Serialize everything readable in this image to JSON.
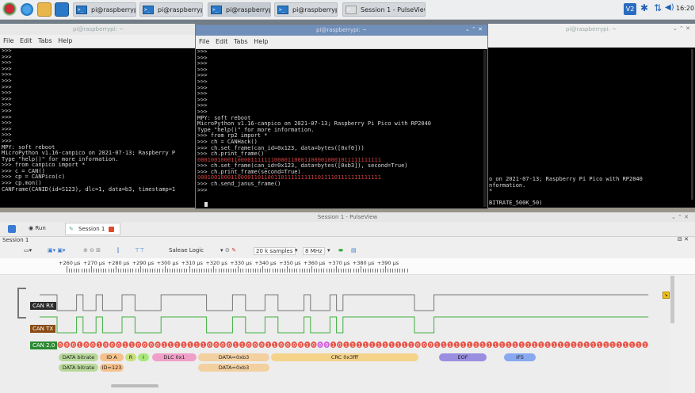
{
  "taskbar": {
    "buttons": [
      "pi@raspberrypi: ~]",
      "pi@raspberrypi: ~",
      "pi@raspberrypi: ~",
      "pi@raspberrypi: ~",
      "Session 1 - PulseView"
    ],
    "clock": "16:20",
    "vnc_label": "V2"
  },
  "term_left": {
    "title": "pi@raspberrypi: ~",
    "menu": [
      "File",
      "Edit",
      "Tabs",
      "Help"
    ],
    "text": ">>>\n>>>\n>>>\n>>>\n>>>\n>>>\n>>>\n>>>\n>>>\n>>>\n>>>\n>>>\n>>>\n>>>\n>>>\n>>>\nMPY: soft reboot\nMicroPython v1.16-canpico on 2021-07-13; Raspberry P\nType \"help()\" for more information.\n>>> from canpico import *\n>>> c = CAN()\n>>> cp = CANPico(c)\n>>> cp.mon()\nCANFrame(CANID(id=S123), dlc=1, data=b3, timestamp=1"
  },
  "term_mid": {
    "title": "pi@raspberrypi: ~",
    "menu": [
      "File",
      "Edit",
      "Tabs",
      "Help"
    ],
    "lines": [
      {
        "t": ">>>",
        "c": "#d8d8d8"
      },
      {
        "t": ">>>",
        "c": "#d8d8d8"
      },
      {
        "t": ">>>",
        "c": "#d8d8d8"
      },
      {
        "t": ">>>",
        "c": "#d8d8d8"
      },
      {
        "t": ">>>",
        "c": "#d8d8d8"
      },
      {
        "t": ">>>",
        "c": "#d8d8d8"
      },
      {
        "t": ">>>",
        "c": "#d8d8d8"
      },
      {
        "t": ">>>",
        "c": "#d8d8d8"
      },
      {
        "t": ">>>",
        "c": "#d8d8d8"
      },
      {
        "t": ">>>",
        "c": "#d8d8d8"
      },
      {
        "t": ">>>",
        "c": "#d8d8d8"
      },
      {
        "t": "MPY: soft reboot",
        "c": "#d8d8d8"
      },
      {
        "t": "MicroPython v1.16-canpico on 2021-07-13; Raspberry Pi Pico with RP2040",
        "c": "#d8d8d8"
      },
      {
        "t": "Type \"help()\" for more information.",
        "c": "#d8d8d8"
      },
      {
        "t": ">>> from rp2 import *",
        "c": "#d8d8d8"
      },
      {
        "t": ">>> ch = CANHack()",
        "c": "#d8d8d8"
      },
      {
        "t": ">>> ch.set_frame(can_id=0x123, data=bytes([0xf0]))",
        "c": "#d8d8d8"
      },
      {
        "t": ">>> ch.print_frame()",
        "c": "#d8d8d8"
      },
      {
        "t": "0001001000110000111111100001100011000010001011111111111",
        "c": "#d04040"
      },
      {
        "t": ">>> ch.set_frame(can_id=0x123, data=bytes([0xb3]), second=True)",
        "c": "#d8d8d8"
      },
      {
        "t": ">>> ch.print_frame(second=True)",
        "c": "#d8d8d8"
      },
      {
        "t": "0001001000110000110110011011111111110111101111111111111",
        "c": "#d04040"
      },
      {
        "t": ">>> ch.send_janus_frame()",
        "c": "#d8d8d8"
      },
      {
        "t": ">>> ",
        "c": "#d8d8d8"
      }
    ]
  },
  "term_right": {
    "title": "pi@raspberrypi: ~",
    "text": "o on 2021-07-13; Raspberry Pi Pico with RP2040\nnformation.\n*\n\nBITRATE_500K_50)\n\n\n dlc=1, data=f0, timestamp=3010937510)"
  },
  "pulseview": {
    "title": "Session 1 - PulseView",
    "run_label": "Run",
    "tab_label": "Session 1",
    "session_label": "Session 1",
    "device": "Saleae Logic",
    "samples": "20 k samples",
    "rate": "8 MHz",
    "ticks": [
      "+260 µs",
      "+270 µs",
      "+280 µs",
      "+290 µs",
      "+300 µs",
      "+310 µs",
      "+320 µs",
      "+330 µs",
      "+340 µs",
      "+350 µs",
      "+360 µs",
      "+370 µs",
      "+380 µs",
      "+390 µs"
    ],
    "channels": [
      "CAN RX",
      "CAN TX"
    ],
    "decoder": "CAN 2.0",
    "bits": "0001001000110000111111100001100011000010001011111111111000111111111111111111111111111111111",
    "annotations_row1": [
      {
        "label": "DATA bitrate",
        "color": "#b8d89a"
      },
      {
        "label": "ID A",
        "color": "#f5c08a"
      },
      {
        "label": "R",
        "color": "#c7e07a"
      },
      {
        "label": "I",
        "color": "#a9e87a"
      },
      {
        "label": "DLC 0x1",
        "color": "#f0a0c8"
      },
      {
        "label": "DATA=0xb3",
        "color": "#f3d0a0"
      },
      {
        "label": "CRC 0x3fff",
        "color": "#f5d38a"
      },
      {
        "label": "EOF",
        "color": "#9a8ee0"
      },
      {
        "label": "IFS",
        "color": "#88a8f0"
      }
    ],
    "annotations_row2": [
      {
        "label": "DATA bitrate",
        "color": "#b8d89a"
      },
      {
        "label": "ID=123",
        "color": "#f5c08a"
      },
      {
        "label": "DATA=0xb3",
        "color": "#f3d0a0"
      }
    ]
  }
}
